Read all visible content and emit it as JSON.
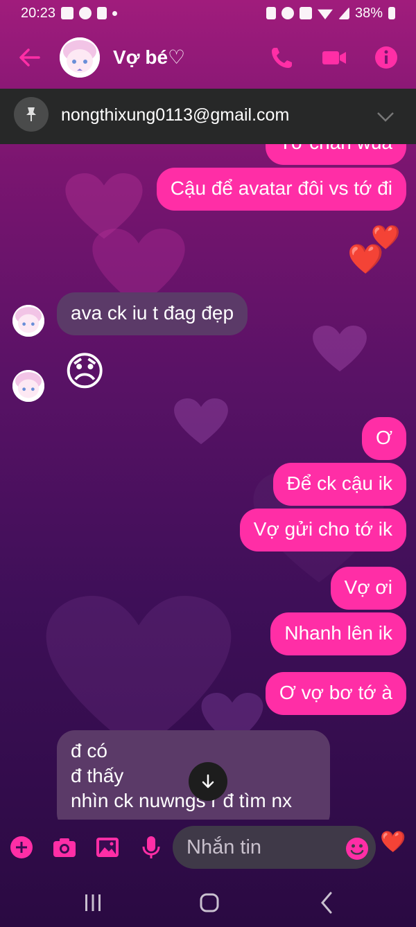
{
  "status_bar": {
    "time": "20:23",
    "battery": "38%"
  },
  "header": {
    "title": "Vợ bé♡",
    "accent": "#ff2ea6"
  },
  "pinned": {
    "text": "nongthixung0113@gmail.com"
  },
  "messages": {
    "m0": "Tớ chán wúa",
    "m1": "Cậu để avatar đôi vs tớ đi",
    "m2": "ava ck iu t đag đẹp",
    "m3": "Ơ",
    "m4": "Để ck cậu ik",
    "m5": "Vợ gửi cho tớ ik",
    "m6": "Vợ ơi",
    "m7": "Nhanh lên ik",
    "m8": "Ơ vợ bơ tớ à",
    "m9": "đ có\nđ thấy\nnhìn ck nuwngs r đ tìm nx"
  },
  "reactions": {
    "hearts": "❤️",
    "sad_emoji": "😞"
  },
  "composer": {
    "placeholder": "Nhắn tin"
  }
}
